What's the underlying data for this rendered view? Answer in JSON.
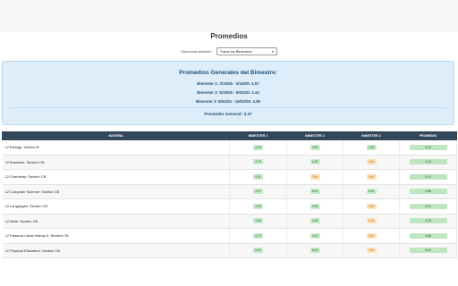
{
  "page": {
    "title": "Promedios"
  },
  "selector": {
    "label": "Seleccionar bimestre:",
    "value": "Todos los Bimestres"
  },
  "summary": {
    "title": "Promedios Generales del Bimestre:",
    "lines": [
      "Bimester 1: 3/10/25 - 5/16/25: 4.57",
      "Bimester 2: 5/19/25 - 8/03/25: 4.44",
      "Bimester 3: 8/04/25 - 10/03/25: 4.09"
    ],
    "general": "Promedio General: 4.37"
  },
  "table": {
    "headers": [
      "MATERIA",
      "BIMESTER 1",
      "BIMESTER 2",
      "BIMESTER 3",
      "PROMEDIO"
    ],
    "rows": [
      {
        "materia": "12 Biology: Section B",
        "b1": "4.34",
        "b2": "4.63",
        "b3": "4.30",
        "prom": "4.13"
      },
      {
        "materia": "12 Business: Section CB",
        "b1": "4.75",
        "b2": "4.15",
        "b3": "N/A",
        "prom": "4.43"
      },
      {
        "materia": "12 Chemistry: Section CB",
        "b1": "4.31",
        "b2": "3.95",
        "b3": "N/A",
        "prom": "4.13"
      },
      {
        "materia": "12 Computer Science: Section CB",
        "b1": "4.47",
        "b2": "5.00",
        "b3": "5.00",
        "prom": "4.88"
      },
      {
        "materia": "12 Languages: Section CB",
        "b1": "4.39",
        "b2": "4.96",
        "b3": "N/A",
        "prom": "4.71"
      },
      {
        "materia": "12 Math: Section CB",
        "b1": "4.46",
        "b2": "4.45",
        "b3": "3.25",
        "prom": "4.15"
      },
      {
        "materia": "12 Panama Canal History II: Section CB",
        "b1": "4.75",
        "b2": "4.42",
        "b3": "N/A",
        "prom": "4.58"
      },
      {
        "materia": "12 Physical Education: Section CB",
        "b1": "5.00",
        "b2": "5.00",
        "b3": "N/A",
        "prom": "5.00"
      }
    ]
  }
}
